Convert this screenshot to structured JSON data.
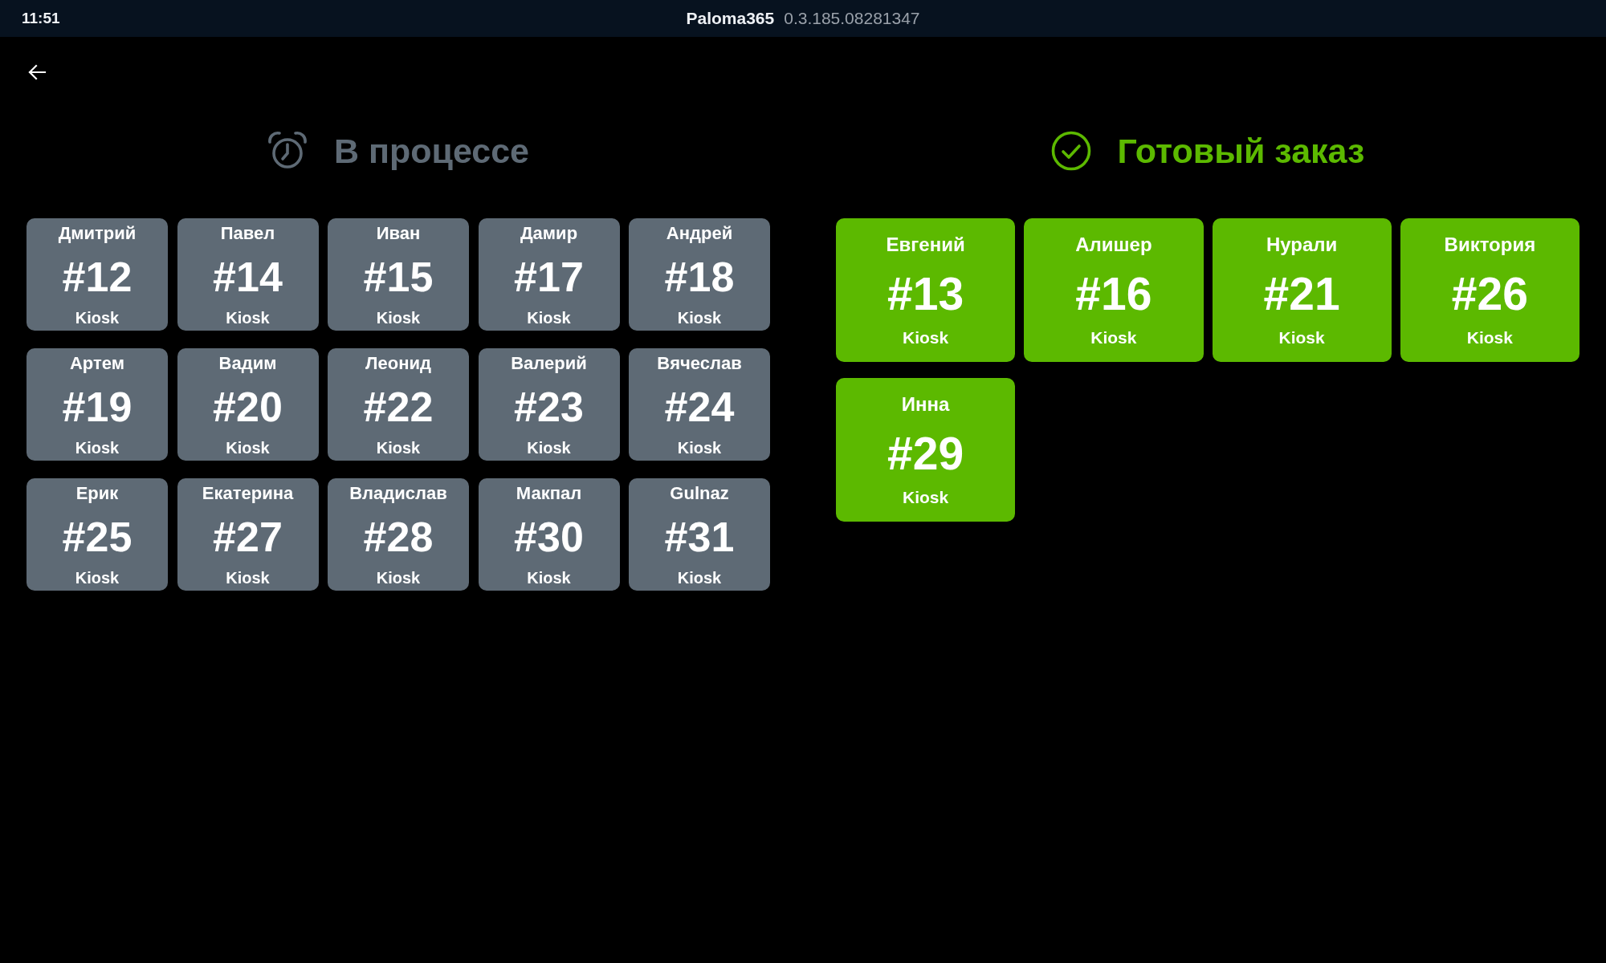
{
  "status_bar": {
    "time": "11:51",
    "app_name": "Paloma365",
    "version": "0.3.185.08281347"
  },
  "sections": [
    {
      "kind": "in_progress",
      "title": "В процессе",
      "orders": [
        {
          "name": "Дмитрий",
          "number": "#12",
          "source": "Kiosk"
        },
        {
          "name": "Павел",
          "number": "#14",
          "source": "Kiosk"
        },
        {
          "name": "Иван",
          "number": "#15",
          "source": "Kiosk"
        },
        {
          "name": "Дамир",
          "number": "#17",
          "source": "Kiosk"
        },
        {
          "name": "Андрей",
          "number": "#18",
          "source": "Kiosk"
        },
        {
          "name": "Артем",
          "number": "#19",
          "source": "Kiosk"
        },
        {
          "name": "Вадим",
          "number": "#20",
          "source": "Kiosk"
        },
        {
          "name": "Леонид",
          "number": "#22",
          "source": "Kiosk"
        },
        {
          "name": "Валерий",
          "number": "#23",
          "source": "Kiosk"
        },
        {
          "name": "Вячеслав",
          "number": "#24",
          "source": "Kiosk"
        },
        {
          "name": "Ерик",
          "number": "#25",
          "source": "Kiosk"
        },
        {
          "name": "Екатерина",
          "number": "#27",
          "source": "Kiosk"
        },
        {
          "name": "Владислав",
          "number": "#28",
          "source": "Kiosk"
        },
        {
          "name": "Макпал",
          "number": "#30",
          "source": "Kiosk"
        },
        {
          "name": "Gulnaz",
          "number": "#31",
          "source": "Kiosk"
        }
      ]
    },
    {
      "kind": "ready",
      "title": "Готовый заказ",
      "orders": [
        {
          "name": "Евгений",
          "number": "#13",
          "source": "Kiosk"
        },
        {
          "name": "Алишер",
          "number": "#16",
          "source": "Kiosk"
        },
        {
          "name": "Нурали",
          "number": "#21",
          "source": "Kiosk"
        },
        {
          "name": "Виктория",
          "number": "#26",
          "source": "Kiosk"
        },
        {
          "name": "Инна",
          "number": "#29",
          "source": "Kiosk"
        }
      ]
    }
  ]
}
